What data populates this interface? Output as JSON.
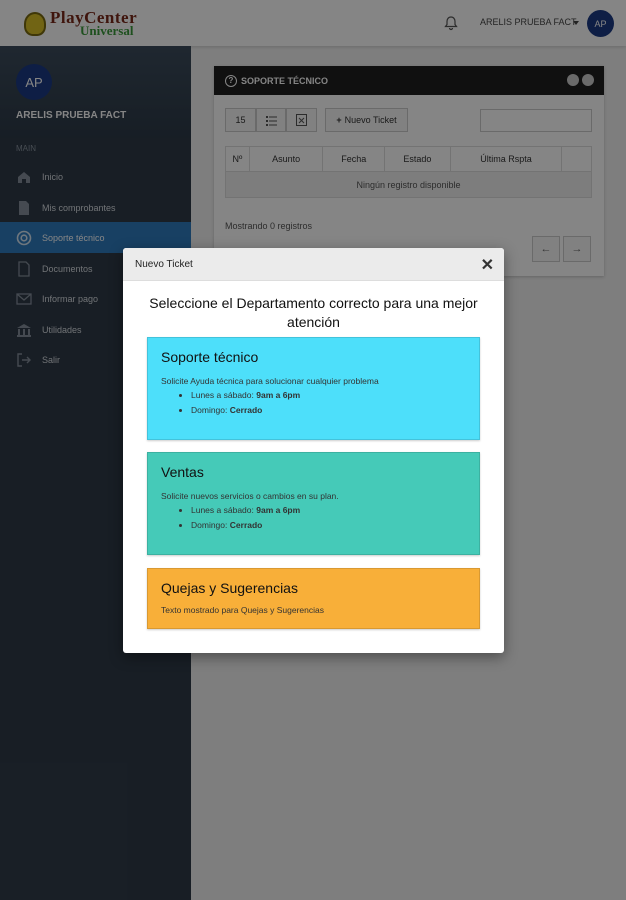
{
  "header": {
    "logo_line1": "PlayCenter",
    "logo_line2": "Universal",
    "username": "ARELIS PRUEBA FACT",
    "avatar_initials": "AP"
  },
  "sidebar": {
    "avatar_initials": "AP",
    "user_name": "ARELIS PRUEBA FACT",
    "section_label": "MAIN",
    "items": [
      {
        "label": "Inicio",
        "icon": "home-icon"
      },
      {
        "label": "Mis comprobantes",
        "icon": "document-icon"
      },
      {
        "label": "Soporte técnico",
        "icon": "lifebuoy-icon",
        "active": true
      },
      {
        "label": "Documentos",
        "icon": "file-icon"
      },
      {
        "label": "Informar pago",
        "icon": "envelope-icon"
      },
      {
        "label": "Utilidades",
        "icon": "bank-icon"
      },
      {
        "label": "Salir",
        "icon": "logout-icon"
      }
    ]
  },
  "panel": {
    "title": "SOPORTE TÉCNICO",
    "page_size": "15",
    "new_ticket_label": "Nuevo Ticket",
    "columns": [
      "Nº",
      "Asunto",
      "Fecha",
      "Estado",
      "Última Rspta"
    ],
    "empty_message": "Ningún registro disponible",
    "showing_text": "Mostrando 0 registros",
    "prev_label": "←",
    "next_label": "→"
  },
  "modal": {
    "title": "Nuevo Ticket",
    "close_label": "✕",
    "prompt": "Seleccione el Departamento correcto para una mejor atención",
    "departments": [
      {
        "name": "Soporte técnico",
        "description": "Solicite Ayuda técnica para solucionar cualquier problema",
        "schedule": [
          {
            "day": "Lunes a sábado:",
            "hours": "9am a 6pm"
          },
          {
            "day": "Domingo:",
            "hours": "Cerrado"
          }
        ],
        "color": "#4ddffa"
      },
      {
        "name": "Ventas",
        "description": "Solicite nuevos servicios o cambios en su plan.",
        "schedule": [
          {
            "day": "Lunes a sábado:",
            "hours": "9am a 6pm"
          },
          {
            "day": "Domingo:",
            "hours": "Cerrado"
          }
        ],
        "color": "#45cab8"
      },
      {
        "name": "Quejas y Sugerencias",
        "description": "Texto mostrado para Quejas y Sugerencias",
        "color": "#f8af39"
      }
    ]
  },
  "colors": {
    "sidebar_bg": "#2f3b48",
    "active_item": "#2e7bbf",
    "avatar": "#1b3b84"
  }
}
